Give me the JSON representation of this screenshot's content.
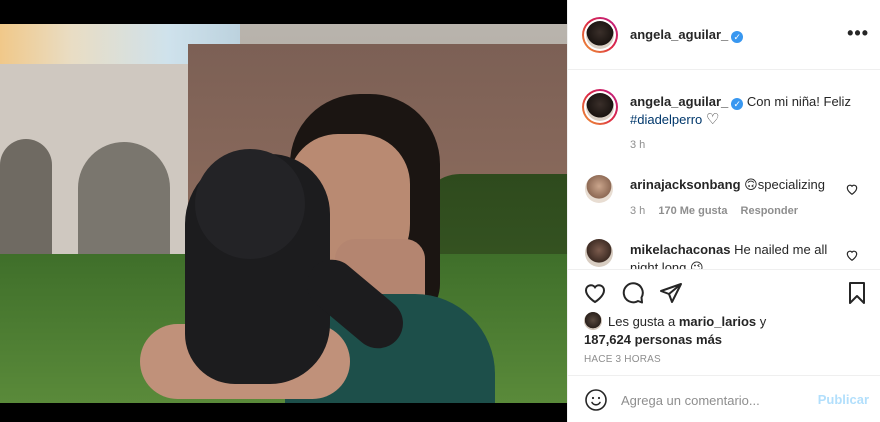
{
  "post": {
    "username": "angela_aguilar_",
    "verified_mark": "✓",
    "more_icon": "more-horizontal-icon",
    "more_label": "•••"
  },
  "caption": {
    "username": "angela_aguilar_",
    "text": "Con mi niña! Feliz",
    "hashtag": "#diadelperro",
    "heart": "♡",
    "time": "3 h"
  },
  "comments": [
    {
      "username": "arinajacksonbang",
      "emoji": "🙃",
      "text": "specializing",
      "time": "3 h",
      "likes": "170 Me gusta",
      "reply": "Responder"
    },
    {
      "username": "mikelachaconas",
      "text": "He nailed me all night long",
      "emoji": "😉"
    }
  ],
  "likes": {
    "prefix": "Les gusta a",
    "user": "mario_larios",
    "conj": "y",
    "count": "187,624 personas más"
  },
  "timestamp": "HACE 3 HORAS",
  "add_comment": {
    "placeholder": "Agrega un comentario...",
    "publish": "Publicar"
  },
  "colors": {
    "accent": "#3897f0",
    "publish_disabled": "#b2dffc",
    "muted": "#8e8e8e",
    "hashtag": "#00376b"
  }
}
